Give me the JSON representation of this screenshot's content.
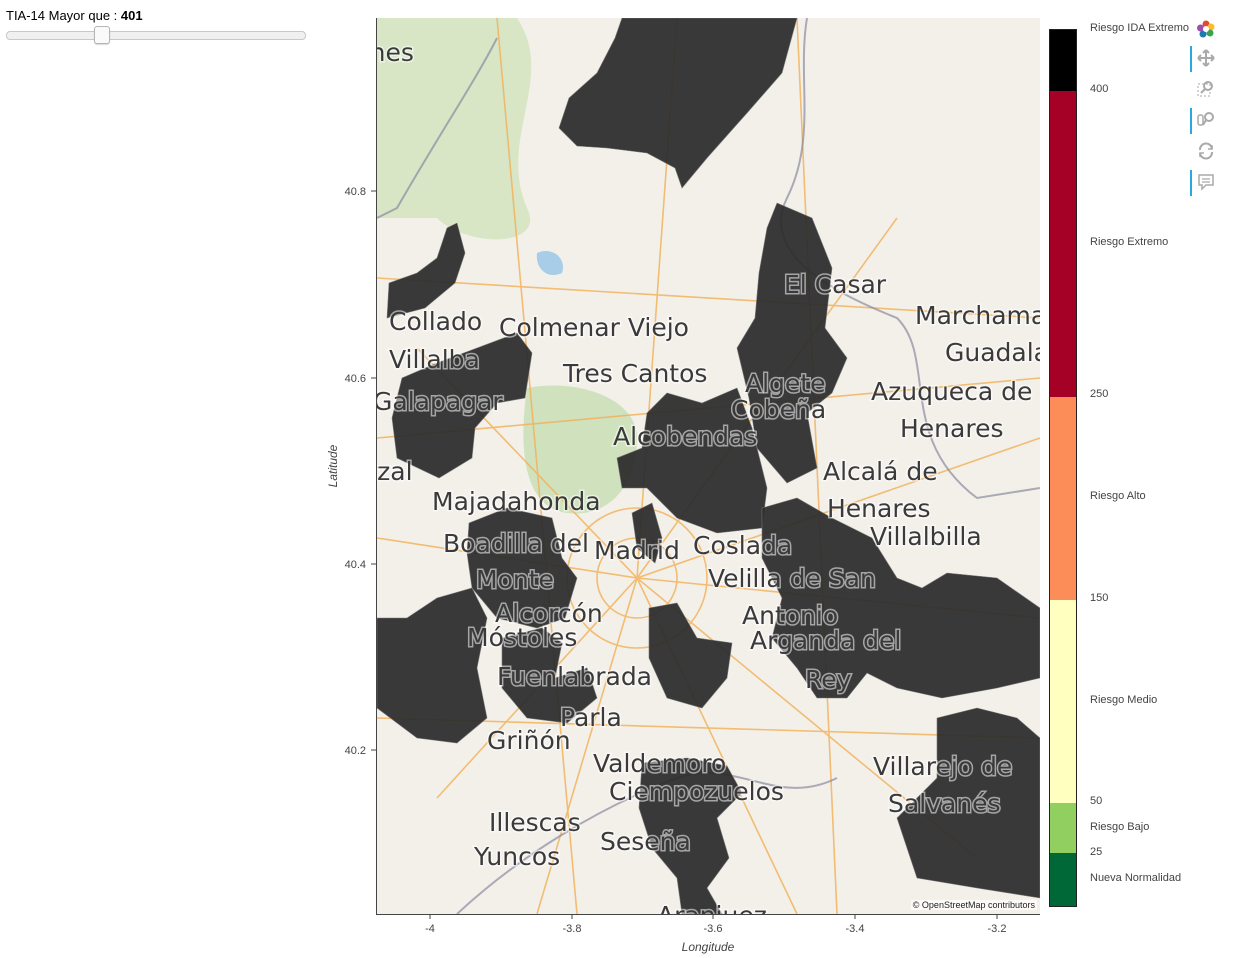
{
  "slider": {
    "label": "TIA-14 Mayor que : ",
    "value": "401",
    "fraction": 0.3
  },
  "map": {
    "xlabel": "Longitude",
    "ylabel": "Latitude",
    "x_ticks": [
      "-4",
      "-3.8",
      "-3.6",
      "-3.4",
      "-3.2"
    ],
    "y_ticks": [
      "40.8",
      "40.6",
      "40.4",
      "40.2"
    ],
    "attribution": "© OpenStreetMap contributors",
    "places": [
      "Collado",
      "Villalba",
      "Galapagar",
      "Colmenar Viejo",
      "Tres Cantos",
      "El Casar",
      "Marchamalo",
      "Guadalajara",
      "Azuqueca de",
      "Henares",
      "Algete",
      "Cobeña",
      "Alcobendas",
      "Alcalá de",
      "Henares",
      "Villalbilla",
      "Majadahonda",
      "Boadilla del",
      "Monte",
      "Madrid",
      "Coslada",
      "Velilla de San",
      "Antonio",
      "Alcorcón",
      "Móstoles",
      "Arganda del",
      "Rey",
      "Fuenlabrada",
      "Parla",
      "Griñón",
      "Valdemoro",
      "Ciempozuelos",
      "Villarejo de",
      "Salvanés",
      "Illescas",
      "Seseña",
      "Yuncos",
      "Aranjuez",
      "Moralzarzal",
      "Torrelodones"
    ]
  },
  "colorbar": {
    "bands": [
      {
        "label": "Riesgo IDA Extremo",
        "color": "#000000"
      },
      {
        "label": "Riesgo Extremo",
        "color": "#a50026"
      },
      {
        "label": "Riesgo Alto",
        "color": "#fc8d59"
      },
      {
        "label": "Riesgo Medio",
        "color": "#ffffbf"
      },
      {
        "label": "Riesgo Bajo",
        "color": "#91cf60"
      },
      {
        "label": "Nueva Normalidad",
        "color": "#006837"
      }
    ],
    "thresholds": [
      "400",
      "250",
      "150",
      "50",
      "25"
    ]
  },
  "toolbar": {
    "tools": [
      {
        "name": "bokeh-logo-icon",
        "active": false
      },
      {
        "name": "pan-icon",
        "active": true
      },
      {
        "name": "box-zoom-icon",
        "active": false
      },
      {
        "name": "wheel-zoom-icon",
        "active": true
      },
      {
        "name": "reset-icon",
        "active": false
      },
      {
        "name": "hover-icon",
        "active": true
      }
    ]
  },
  "colors": {
    "region_fill": "#2b2b2b",
    "map_background": "#f3f0ea",
    "accent": "#26aae1"
  }
}
